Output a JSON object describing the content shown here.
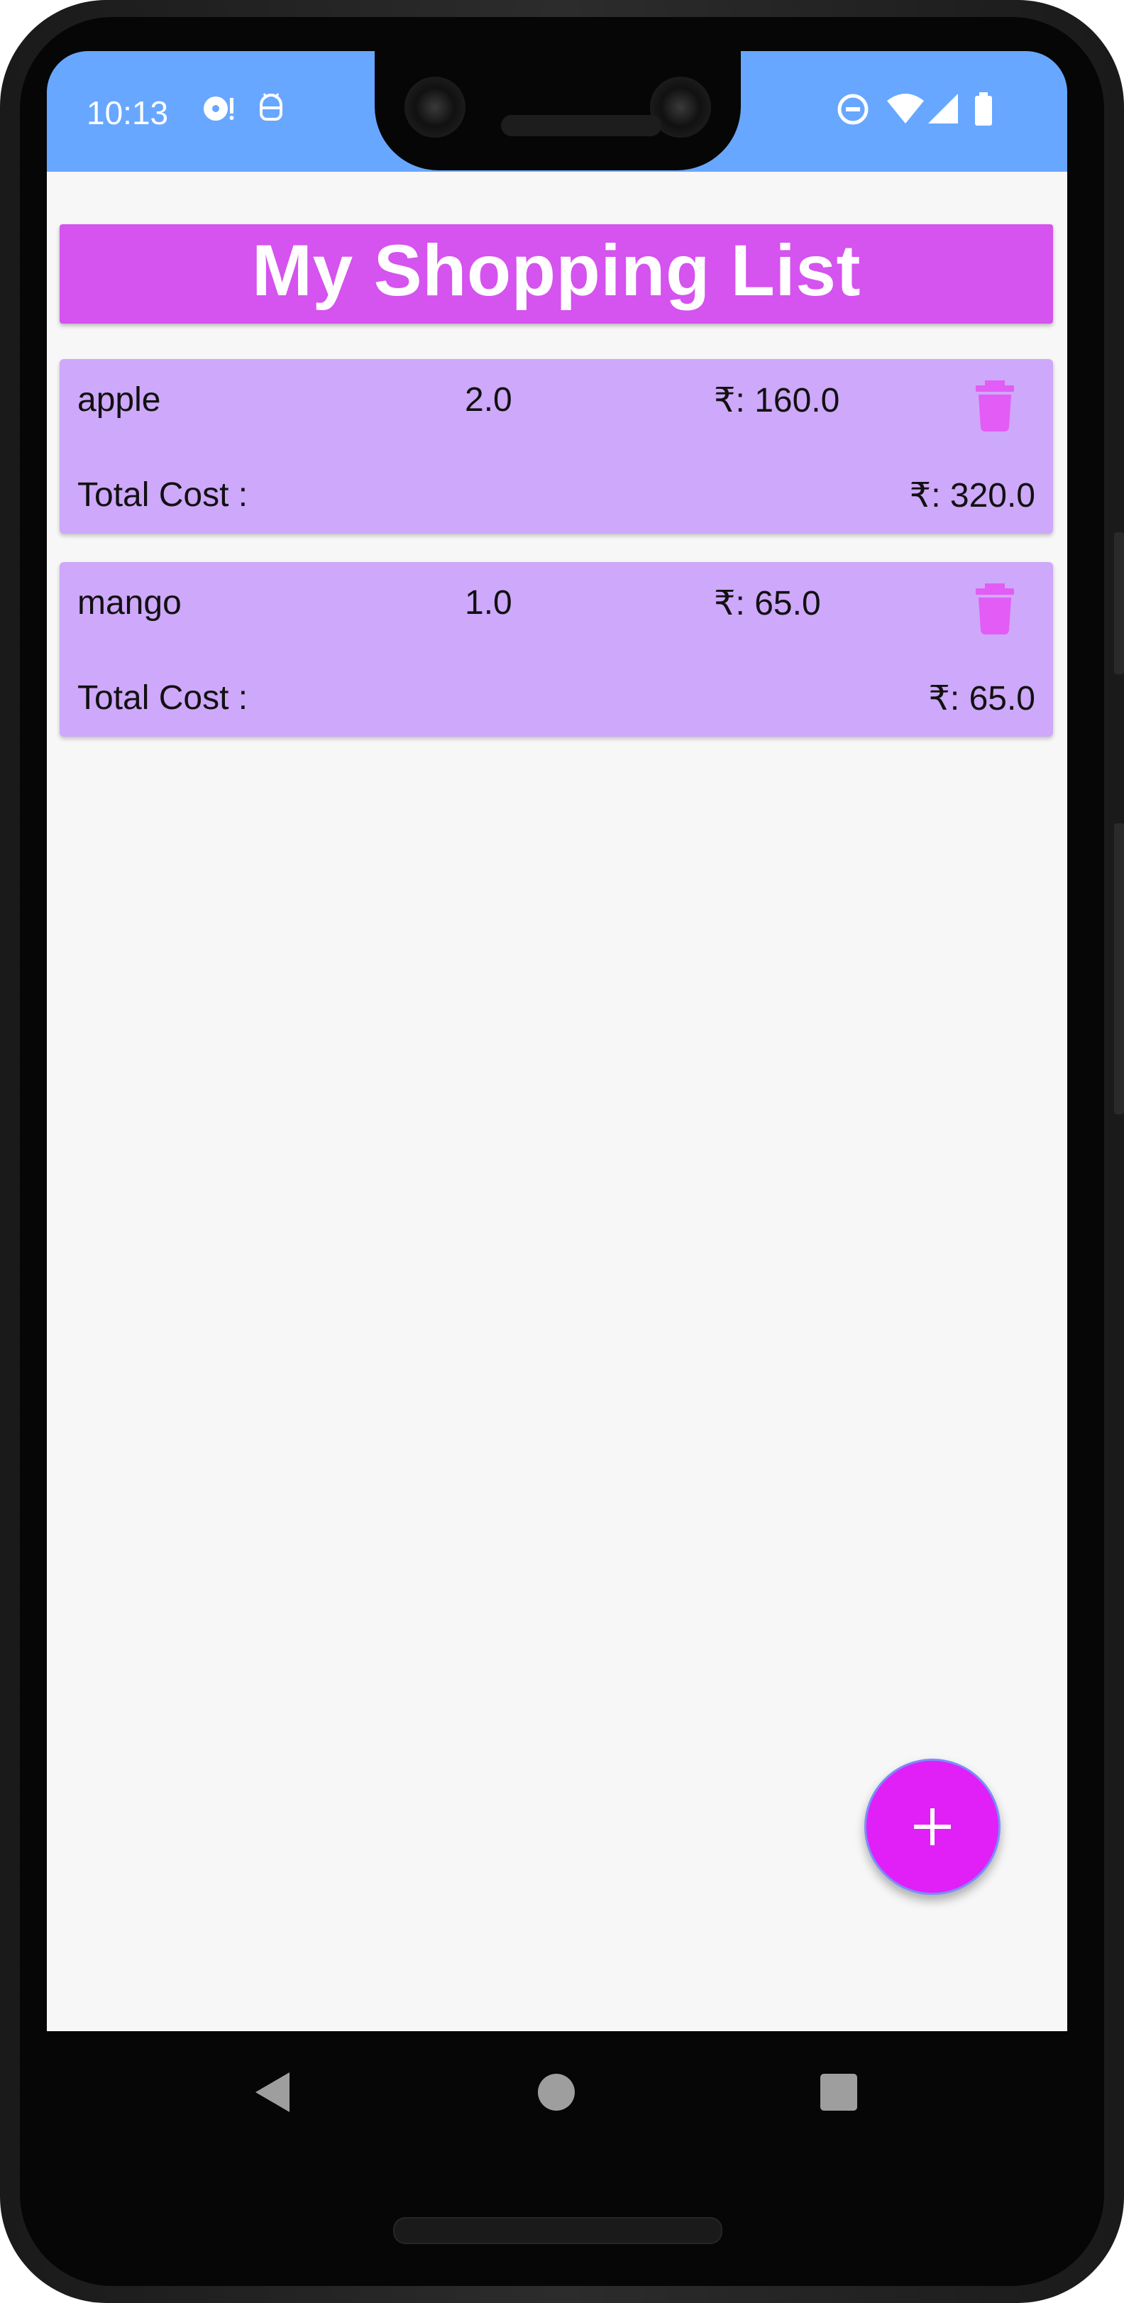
{
  "status_bar": {
    "time": "10:13"
  },
  "header": {
    "title": "My Shopping List"
  },
  "items": [
    {
      "name": "apple",
      "quantity": "2.0",
      "price": "₹: 160.0",
      "total_label": "Total Cost :",
      "total_value": "₹: 320.0"
    },
    {
      "name": "mango",
      "quantity": "1.0",
      "price": "₹: 65.0",
      "total_label": "Total Cost :",
      "total_value": "₹: 65.0"
    }
  ],
  "colors": {
    "status_bar": "#67a7ff",
    "app_bar": "#d553ee",
    "card": "#cea8fa",
    "delete_icon": "#e35cf5",
    "fab": "#e020f6",
    "background": "#f7f7f7"
  },
  "icons": {
    "delete": "trash-icon",
    "fab": "plus-icon",
    "nav_back": "back-triangle-icon",
    "nav_home": "home-circle-icon",
    "nav_recents": "recents-square-icon"
  }
}
